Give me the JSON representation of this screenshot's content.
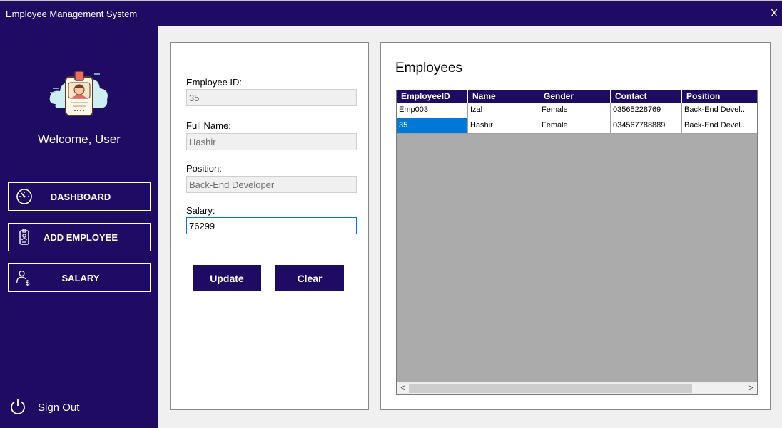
{
  "window": {
    "title": "Employee Management System",
    "close_label": "X"
  },
  "sidebar": {
    "avatar_icon": "employee-id-badge-icon",
    "welcome": "Welcome, User",
    "items": [
      {
        "label": "DASHBOARD",
        "icon": "speedometer-icon"
      },
      {
        "label": "ADD EMPLOYEE",
        "icon": "id-badge-icon"
      },
      {
        "label": "SALARY",
        "icon": "user-dollar-icon"
      }
    ],
    "signout": {
      "label": "Sign Out",
      "icon": "power-icon"
    }
  },
  "form": {
    "employee_id": {
      "label": "Employee ID:",
      "value": "35"
    },
    "full_name": {
      "label": "Full Name:",
      "value": "Hashir"
    },
    "position": {
      "label": "Position:",
      "value": "Back-End Developer"
    },
    "salary": {
      "label": "Salary:",
      "value": "76299"
    },
    "update_label": "Update",
    "clear_label": "Clear"
  },
  "table": {
    "title": "Employees",
    "columns": [
      "EmployeeID",
      "Name",
      "Gender",
      "Contact",
      "Position"
    ],
    "rows": [
      [
        "Emp003",
        "Izah",
        "Female",
        "03565228769",
        "Back-End Devel..."
      ],
      [
        "35",
        "Hashir",
        "Female",
        "034567788889",
        "Back-End Devel..."
      ]
    ],
    "selected_row": 1,
    "scroll_left": "<",
    "scroll_right": ">"
  },
  "colors": {
    "primary": "#200b63",
    "selection": "#0078d7",
    "grid_background": "#ababab"
  }
}
